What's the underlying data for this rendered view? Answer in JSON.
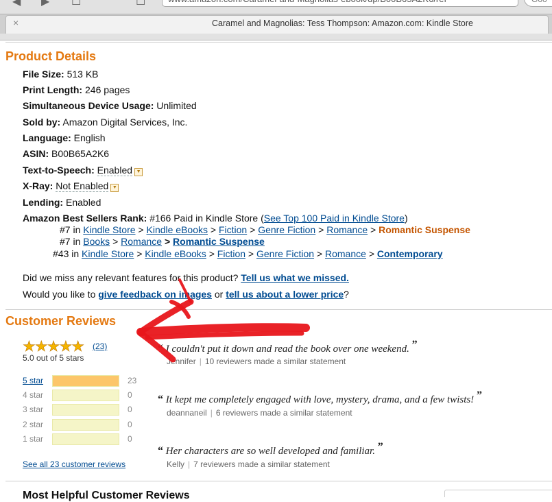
{
  "browser": {
    "url_text": "www.amazon.com/Caramel-and-Magnolias-ebook/dp/B00B65A2K6/ref",
    "search_text": "Goo",
    "tab_title": "Caramel and Magnolias: Tess Thompson: Amazon.com: Kindle Store",
    "tab_close": "×"
  },
  "product_details": {
    "title": "Product Details",
    "items": [
      {
        "label": "File Size:",
        "value": "513 KB"
      },
      {
        "label": "Print Length:",
        "value": "246 pages"
      },
      {
        "label": "Simultaneous Device Usage:",
        "value": "Unlimited"
      },
      {
        "label": "Sold by:",
        "value": "Amazon Digital Services, Inc."
      },
      {
        "label": "Language:",
        "value": "English"
      },
      {
        "label": "ASIN:",
        "value": "B00B65A2K6"
      },
      {
        "label": "Text-to-Speech:",
        "value": "Enabled"
      },
      {
        "label": "X-Ray:",
        "value": "Not Enabled"
      },
      {
        "label": "Lending:",
        "value": "Enabled"
      }
    ],
    "rank": {
      "label": "Amazon Best Sellers Rank:",
      "value": "#166 Paid in Kindle Store (",
      "link": "See Top 100 Paid in Kindle Store",
      "close": ")",
      "sub1": {
        "num": "#7 in",
        "path": [
          "Kindle Store",
          "Kindle eBooks",
          "Fiction",
          "Genre Fiction",
          "Romance"
        ],
        "final": "Romantic Suspense"
      },
      "sub2": {
        "num": "#7 in",
        "path": [
          "Books",
          "Romance"
        ],
        "final": "Romantic Suspense"
      },
      "sub3": {
        "num": "#43 in",
        "path": [
          "Kindle Store",
          "Kindle eBooks",
          "Fiction",
          "Genre Fiction",
          "Romance"
        ],
        "final": "Contemporary"
      },
      "sep": ">"
    },
    "feedback1": {
      "text": "Did we miss any relevant features for this product?",
      "link": "Tell us what we missed."
    },
    "feedback2": {
      "text": "Would you like to",
      "link1": "give feedback on images",
      "or": "or",
      "link2": "tell us about a lower price",
      "end": "?"
    }
  },
  "reviews": {
    "title": "Customer Reviews",
    "stars": "★★★★★",
    "count": "(23)",
    "rating": 5.0,
    "rating_text": "5.0 out of 5 stars",
    "histogram": [
      {
        "label": "5 star",
        "count": "23",
        "fraction": 1.0,
        "link": true
      },
      {
        "label": "4 star",
        "count": "0",
        "fraction": 0.0,
        "link": false
      },
      {
        "label": "3 star",
        "count": "0",
        "fraction": 0.0,
        "link": false
      },
      {
        "label": "2 star",
        "count": "0",
        "fraction": 0.0,
        "link": false
      },
      {
        "label": "1 star",
        "count": "0",
        "fraction": 0.0,
        "link": false
      }
    ],
    "see_all": "See all 23 customer reviews",
    "quotes": [
      {
        "text": "I couldn't put it down and read the book over one weekend.",
        "author": "Jennifer",
        "note": "10 reviewers made a similar statement"
      },
      {
        "text": "It kept me completely engaged with love, mystery, drama, and a few twists!",
        "author": "deannaneil",
        "note": "6 reviewers made a similar statement"
      },
      {
        "text": "Her characters are so well developed and familiar.",
        "author": "Kelly",
        "note": "7 reviewers made a similar statement"
      }
    ],
    "open_quote": "“",
    "close_quote": "”",
    "sep": "|"
  },
  "bottom": {
    "heading": "Most Helpful Customer Reviews"
  },
  "annotation": {
    "arrow_color": "#e8161b"
  }
}
